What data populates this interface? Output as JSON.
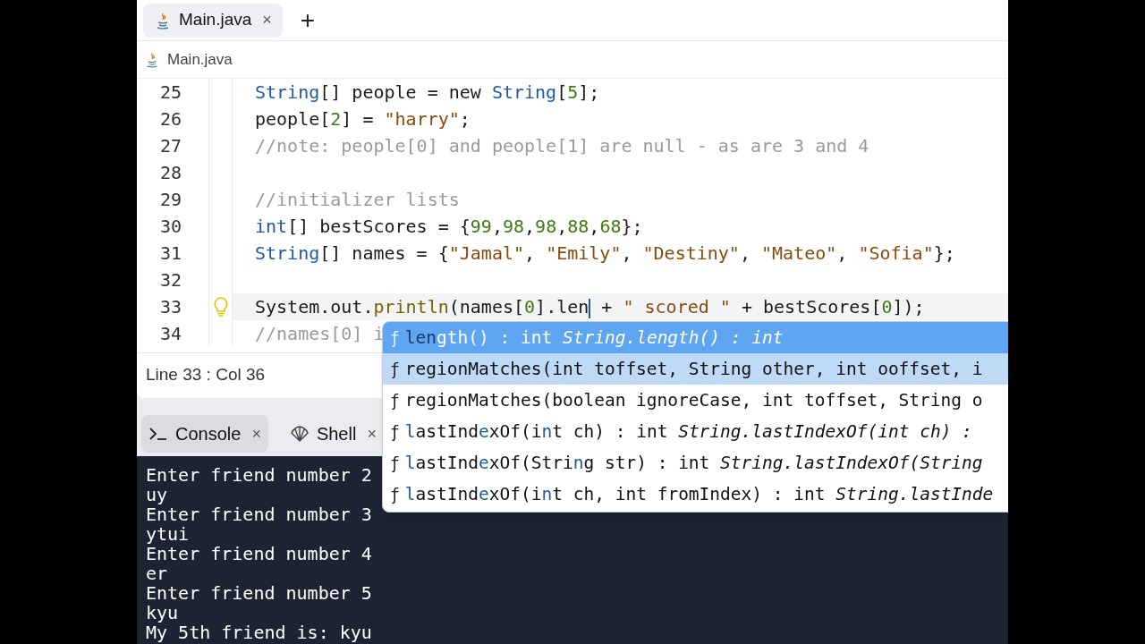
{
  "tabs": [
    {
      "label": "Main.java",
      "close": "×",
      "selected": true
    }
  ],
  "new_tab": "+",
  "breadcrumb": "Main.java",
  "code_lines": [
    {
      "number": "25",
      "current": false,
      "hint": false,
      "tokens": [
        {
          "kind": "type",
          "text": "String"
        },
        {
          "kind": "plain",
          "text": "[] people = new "
        },
        {
          "kind": "type",
          "text": "String"
        },
        {
          "kind": "plain",
          "text": "["
        },
        {
          "kind": "number",
          "text": "5"
        },
        {
          "kind": "plain",
          "text": "];"
        }
      ]
    },
    {
      "number": "26",
      "current": false,
      "hint": false,
      "tokens": [
        {
          "kind": "plain",
          "text": "people["
        },
        {
          "kind": "number",
          "text": "2"
        },
        {
          "kind": "plain",
          "text": "] = "
        },
        {
          "kind": "string",
          "text": "\"harry\""
        },
        {
          "kind": "plain",
          "text": ";"
        }
      ]
    },
    {
      "number": "27",
      "current": false,
      "hint": false,
      "tokens": [
        {
          "kind": "comment",
          "text": "//note: people[0] and people[1] are null - as are 3 and 4"
        }
      ]
    },
    {
      "number": "28",
      "current": false,
      "hint": false
    },
    {
      "number": "29",
      "current": false,
      "hint": false,
      "tokens": [
        {
          "kind": "comment",
          "text": "//initializer lists"
        }
      ]
    },
    {
      "number": "30",
      "current": false,
      "hint": false,
      "tokens": [
        {
          "kind": "type",
          "text": "int"
        },
        {
          "kind": "plain",
          "text": "[] bestScores = {"
        },
        {
          "kind": "number",
          "text": "99"
        },
        {
          "kind": "plain",
          "text": ","
        },
        {
          "kind": "number",
          "text": "98"
        },
        {
          "kind": "plain",
          "text": ","
        },
        {
          "kind": "number",
          "text": "98"
        },
        {
          "kind": "plain",
          "text": ","
        },
        {
          "kind": "number",
          "text": "88"
        },
        {
          "kind": "plain",
          "text": ","
        },
        {
          "kind": "number",
          "text": "68"
        },
        {
          "kind": "plain",
          "text": "};"
        }
      ]
    },
    {
      "number": "31",
      "current": false,
      "hint": false,
      "tokens": [
        {
          "kind": "type",
          "text": "String"
        },
        {
          "kind": "plain",
          "text": "[] names = {"
        },
        {
          "kind": "string",
          "text": "\"Jamal\""
        },
        {
          "kind": "plain",
          "text": ", "
        },
        {
          "kind": "string",
          "text": "\"Emily\""
        },
        {
          "kind": "plain",
          "text": ", "
        },
        {
          "kind": "string",
          "text": "\"Destiny\""
        },
        {
          "kind": "plain",
          "text": ", "
        },
        {
          "kind": "string",
          "text": "\"Mateo\""
        },
        {
          "kind": "plain",
          "text": ", "
        },
        {
          "kind": "string",
          "text": "\"Sofia\""
        },
        {
          "kind": "plain",
          "text": "};"
        }
      ]
    },
    {
      "number": "32",
      "current": false,
      "hint": false
    },
    {
      "number": "33",
      "current": true,
      "hint": true,
      "tokens": [
        {
          "kind": "plain",
          "text": "System.out."
        },
        {
          "kind": "method",
          "text": "println"
        },
        {
          "kind": "plain",
          "text": "(names["
        },
        {
          "kind": "number",
          "text": "0"
        },
        {
          "kind": "plain",
          "text": "].len"
        },
        {
          "kind": "cursor"
        },
        {
          "kind": "plain",
          "text": " + "
        },
        {
          "kind": "string",
          "text": "\" scored \""
        },
        {
          "kind": "plain",
          "text": " + bestScores["
        },
        {
          "kind": "number",
          "text": "0"
        },
        {
          "kind": "plain",
          "text": "]);"
        }
      ]
    },
    {
      "number": "34",
      "current": false,
      "hint": false,
      "tokens": [
        {
          "kind": "comment",
          "text": "//names[0] i"
        }
      ]
    }
  ],
  "status": "Line 33 : Col 36",
  "panel_tabs": [
    {
      "kind": "console",
      "label": "Console",
      "close": "×",
      "selected": true
    },
    {
      "kind": "shell",
      "label": "Shell",
      "close": "×",
      "selected": false
    }
  ],
  "console_lines": [
    "Enter friend number 2",
    "uy",
    "Enter friend number 3",
    "ytui",
    "Enter friend number 4",
    "er",
    "Enter friend number 5",
    "kyu",
    "My 5th friend is: kyu"
  ],
  "suggestions": [
    {
      "icon": "ƒ",
      "selected": true,
      "hovered": false,
      "segments": [
        {
          "kind": "match",
          "text": "len"
        },
        {
          "kind": "plain",
          "text": "gth() : int "
        },
        {
          "kind": "italic",
          "text": "String.length() : int"
        }
      ]
    },
    {
      "icon": "ƒ",
      "selected": false,
      "hovered": true,
      "segments": [
        {
          "kind": "plain",
          "text": "regionMatches(int toffset, String other, int ooffset, i"
        }
      ]
    },
    {
      "icon": "ƒ",
      "selected": false,
      "hovered": false,
      "segments": [
        {
          "kind": "plain",
          "text": "regionMatches(boolean ignoreCase, int toffset, String o"
        }
      ]
    },
    {
      "icon": "ƒ",
      "selected": false,
      "hovered": false,
      "segments": [
        {
          "kind": "match",
          "text": "l"
        },
        {
          "kind": "plain",
          "text": "astInd"
        },
        {
          "kind": "match",
          "text": "e"
        },
        {
          "kind": "plain",
          "text": "xOf(i"
        },
        {
          "kind": "match",
          "text": "n"
        },
        {
          "kind": "plain",
          "text": "t ch) : int "
        },
        {
          "kind": "italic",
          "text": "String.lastIndexOf(int ch) :"
        }
      ]
    },
    {
      "icon": "ƒ",
      "selected": false,
      "hovered": false,
      "segments": [
        {
          "kind": "match",
          "text": "l"
        },
        {
          "kind": "plain",
          "text": "astInd"
        },
        {
          "kind": "match",
          "text": "e"
        },
        {
          "kind": "plain",
          "text": "xOf(Stri"
        },
        {
          "kind": "match",
          "text": "n"
        },
        {
          "kind": "plain",
          "text": "g str) : int "
        },
        {
          "kind": "italic",
          "text": "String.lastIndexOf(String"
        }
      ]
    },
    {
      "icon": "ƒ",
      "selected": false,
      "hovered": false,
      "segments": [
        {
          "kind": "match",
          "text": "l"
        },
        {
          "kind": "plain",
          "text": "astInd"
        },
        {
          "kind": "match",
          "text": "e"
        },
        {
          "kind": "plain",
          "text": "xOf(i"
        },
        {
          "kind": "match",
          "text": "n"
        },
        {
          "kind": "plain",
          "text": "t ch, int fromIndex) : int "
        },
        {
          "kind": "italic",
          "text": "String.lastInde"
        }
      ]
    }
  ]
}
